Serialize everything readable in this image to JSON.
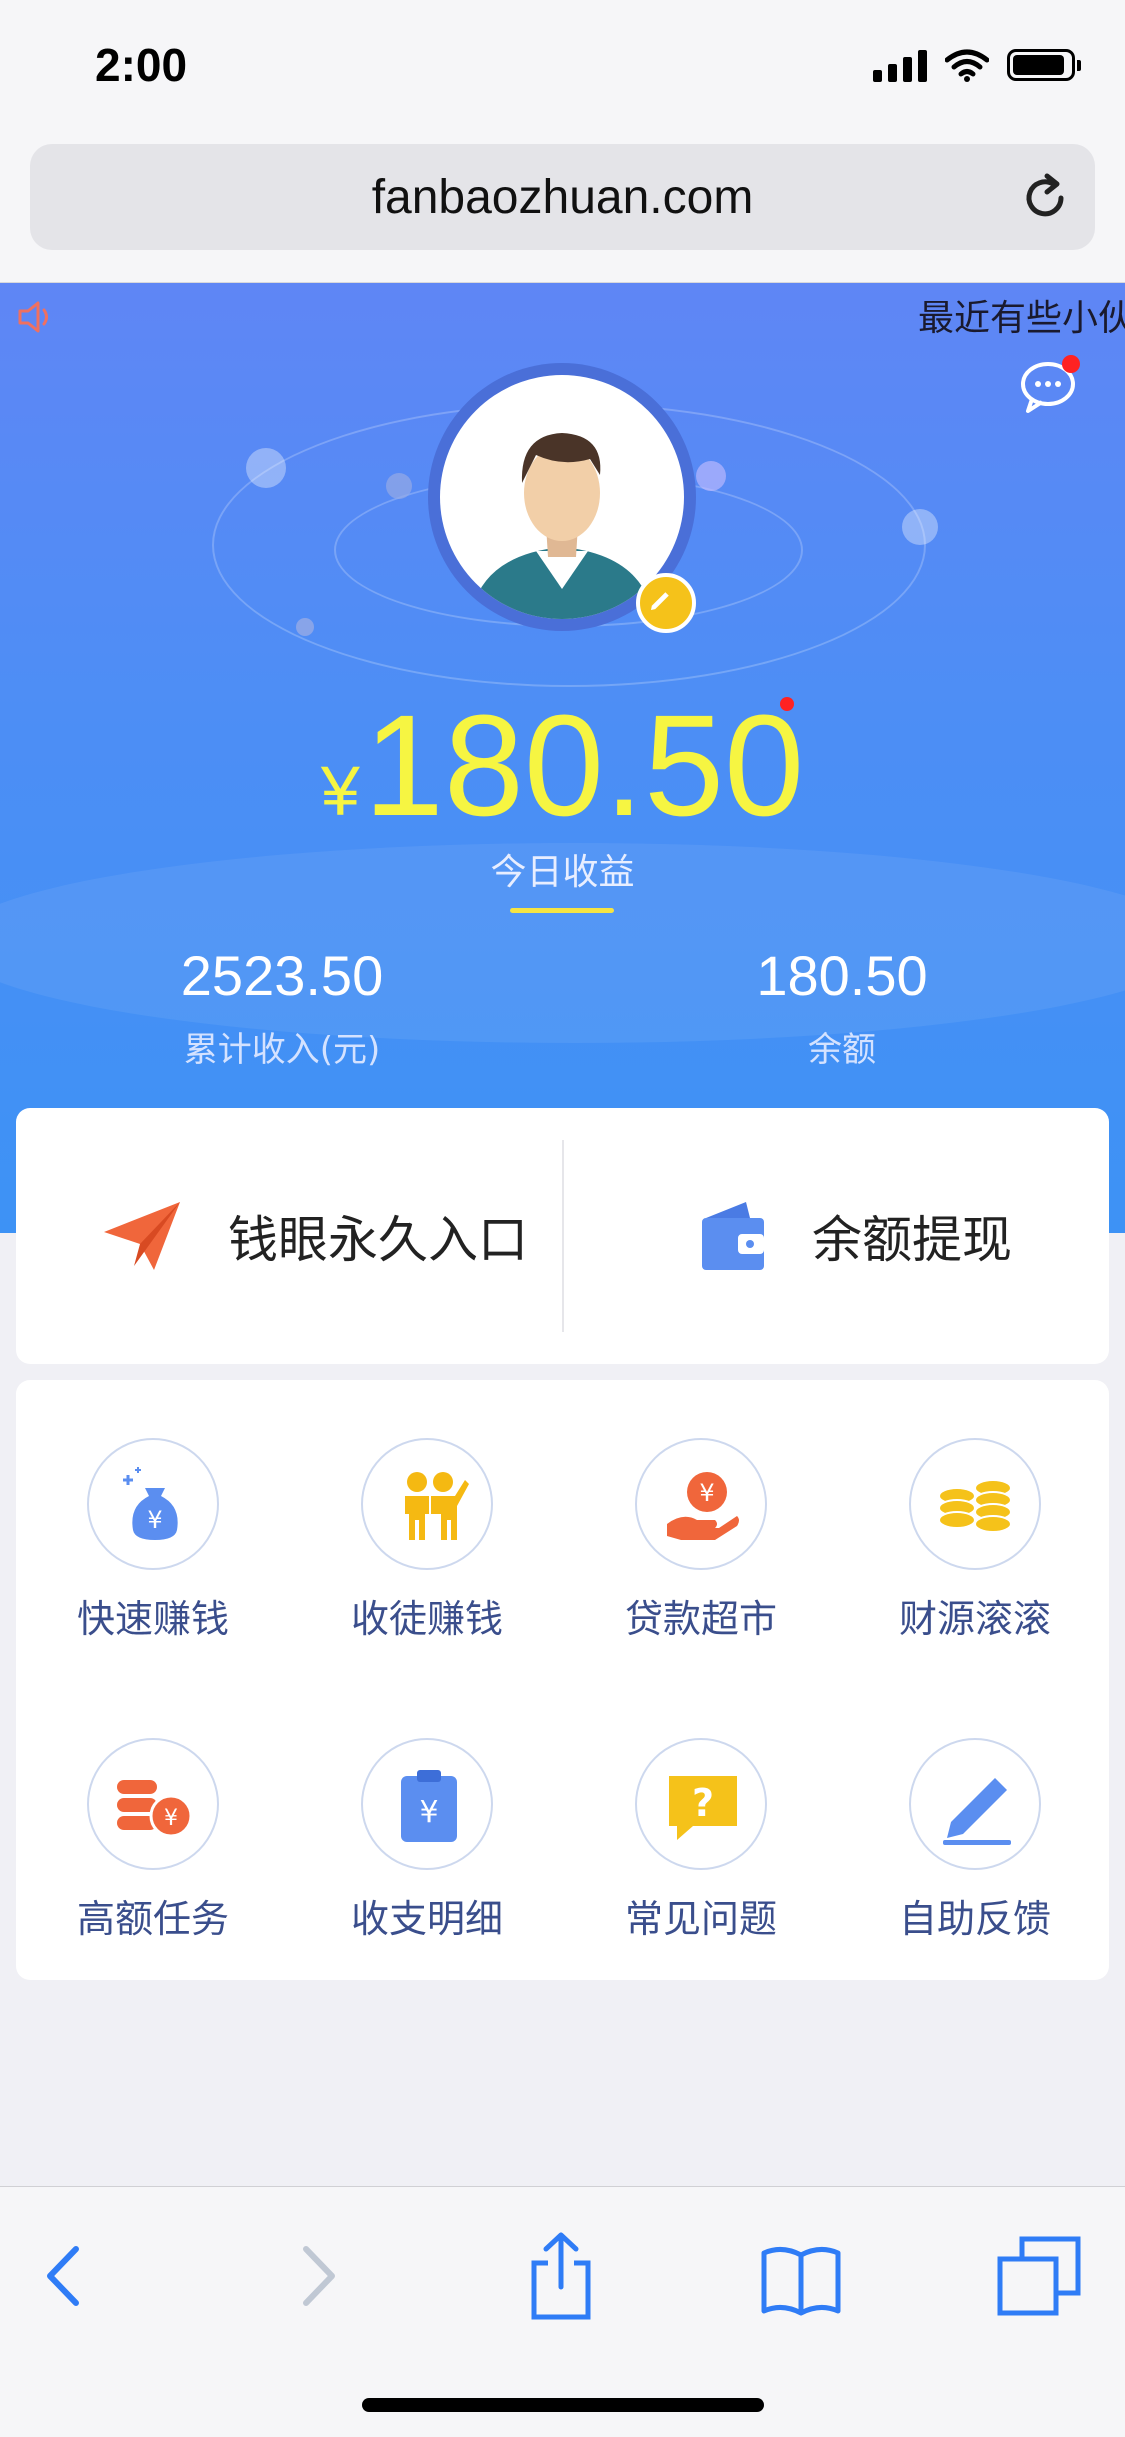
{
  "status_bar": {
    "time": "2:00"
  },
  "browser": {
    "url": "fanbaozhuan.com"
  },
  "hero": {
    "marquee_text": "最近有些小伙",
    "currency_symbol": "¥",
    "today_amount": "180.50",
    "today_label": "今日收益",
    "total_income_value": "2523.50",
    "total_income_label": "累计收入(元)",
    "balance_value": "180.50",
    "balance_label": "余额"
  },
  "entries": [
    {
      "label": "钱眼永久入口",
      "icon": "paper-plane-icon"
    },
    {
      "label": "余额提现",
      "icon": "wallet-icon"
    }
  ],
  "grid": [
    {
      "label": "快速赚钱",
      "icon": "money-bag-icon"
    },
    {
      "label": "收徒赚钱",
      "icon": "people-icon"
    },
    {
      "label": "贷款超市",
      "icon": "coin-hand-icon"
    },
    {
      "label": "财源滚滚",
      "icon": "coin-stack-icon"
    },
    {
      "label": "高额任务",
      "icon": "coins-yen-icon"
    },
    {
      "label": "收支明细",
      "icon": "clipboard-yen-icon"
    },
    {
      "label": "常见问题",
      "icon": "question-icon"
    },
    {
      "label": "自助反馈",
      "icon": "pencil-icon"
    }
  ],
  "colors": {
    "hero_top": "#5f86f5",
    "hero_bottom": "#3d92f5",
    "amount": "#f6f542",
    "accent_orange": "#f0663b",
    "accent_blue": "#5b8ef0",
    "accent_yellow": "#f5c21a"
  }
}
